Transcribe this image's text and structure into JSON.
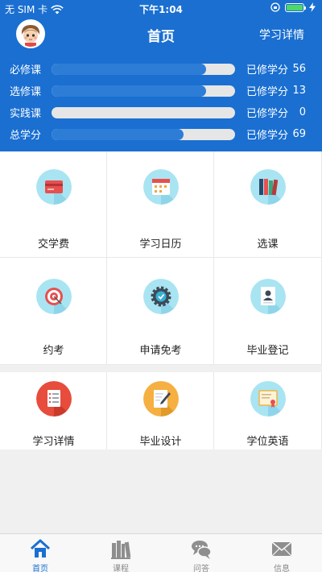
{
  "status_bar": {
    "carrier": "无 SIM 卡",
    "time": "下午1:04"
  },
  "header": {
    "title": "首页",
    "detail_link": "学习详情"
  },
  "credits": [
    {
      "name": "必修课",
      "unit": "已修学分",
      "value": "56",
      "progress": 0.84
    },
    {
      "name": "选修课",
      "unit": "已修学分",
      "value": "13",
      "progress": 0.84
    },
    {
      "name": "实践课",
      "unit": "已修学分",
      "value": "0",
      "progress": 0.0
    },
    {
      "name": "总学分",
      "unit": "已修学分",
      "value": "69",
      "progress": 0.72
    }
  ],
  "grid_top": [
    {
      "label": "交学费",
      "icon": "credit-card-icon"
    },
    {
      "label": "学习日历",
      "icon": "calendar-icon"
    },
    {
      "label": "选课",
      "icon": "books-icon"
    },
    {
      "label": "约考",
      "icon": "target-icon"
    },
    {
      "label": "申请免考",
      "icon": "gear-check-icon"
    },
    {
      "label": "毕业登记",
      "icon": "profile-card-icon"
    }
  ],
  "grid_bottom": [
    {
      "label": "学习详情",
      "icon": "checklist-icon"
    },
    {
      "label": "毕业设计",
      "icon": "pen-document-icon"
    },
    {
      "label": "学位英语",
      "icon": "certificate-icon"
    }
  ],
  "tabs": [
    {
      "label": "首页",
      "icon": "home-icon",
      "active": true
    },
    {
      "label": "课程",
      "icon": "books-icon",
      "active": false
    },
    {
      "label": "问答",
      "icon": "chat-icon",
      "active": false
    },
    {
      "label": "信息",
      "icon": "mail-icon",
      "active": false
    }
  ],
  "colors": {
    "primary": "#1a6fd1",
    "progress": "#2d7dd6",
    "track": "#e6e6e6",
    "battery": "#4cd964"
  }
}
